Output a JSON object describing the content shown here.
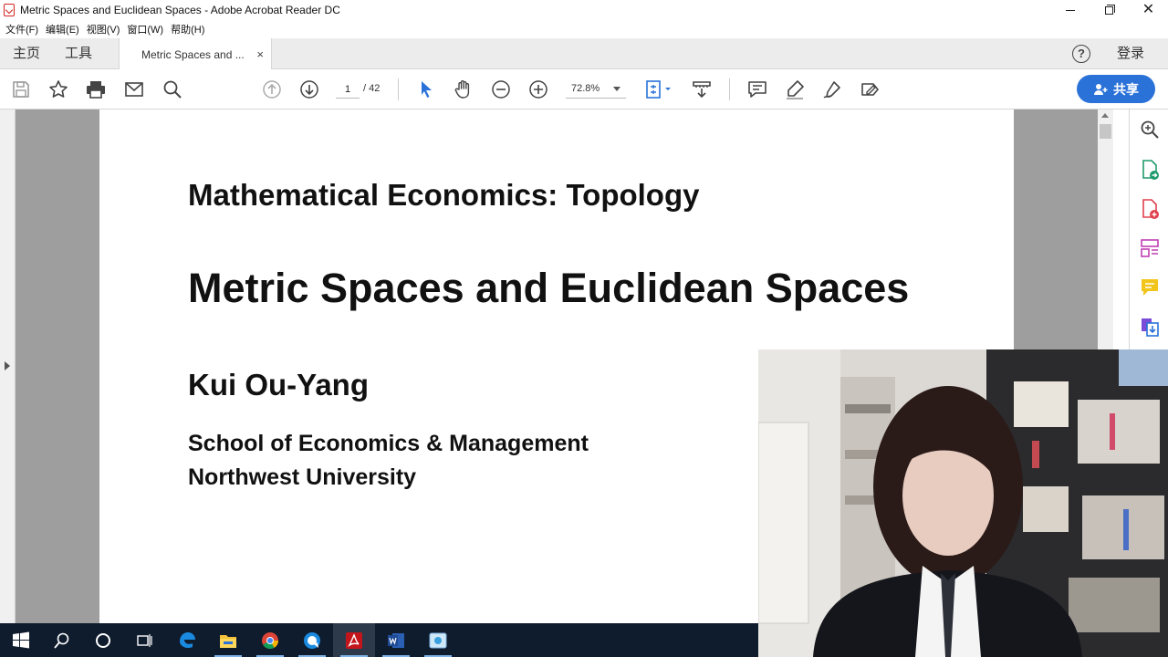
{
  "window": {
    "title": "Metric Spaces and Euclidean Spaces - Adobe Acrobat Reader DC",
    "minimize": "–",
    "close": "✕"
  },
  "menu": [
    "文件(F)",
    "编辑(E)",
    "视图(V)",
    "窗口(W)",
    "帮助(H)"
  ],
  "tabs": {
    "home": "主页",
    "tools": "工具",
    "document": "Metric Spaces and ...",
    "document_close": "×",
    "help": "?",
    "login": "登录"
  },
  "toolbar": {
    "page_current": "1",
    "page_total": "/ 42",
    "zoom": "72.8%",
    "share_label": "共享",
    "icons": [
      "save-icon",
      "bookmark-star-icon",
      "print-icon",
      "email-icon",
      "search-icon",
      "prev-page-icon",
      "next-page-icon",
      "select-cursor-icon",
      "hand-tool-icon",
      "zoom-out-icon",
      "zoom-in-icon",
      "fit-page-icon",
      "scroll-mode-icon",
      "comment-icon",
      "highlight-pen-icon",
      "sign-icon",
      "fill-sign-icon"
    ]
  },
  "document": {
    "course_title": "Mathematical Economics: Topology",
    "title": "Metric Spaces and Euclidean Spaces",
    "author": "Kui Ou-Yang",
    "affiliation_1": "School of Economics & Management",
    "affiliation_2": "Northwest University"
  },
  "right_pane": {
    "icons": [
      "enhance-zoom-icon",
      "export-pdf-icon",
      "create-pdf-icon",
      "organize-pages-icon",
      "comment-tool-icon",
      "send-files-icon"
    ]
  },
  "taskbar": {
    "icons": [
      "windows-start-icon",
      "search-icon",
      "cortana-icon",
      "task-view-icon",
      "edge-icon",
      "file-explorer-icon",
      "chrome-icon",
      "messenger-icon",
      "acrobat-icon",
      "word-icon",
      "screen-capture-icon"
    ]
  },
  "colors": {
    "accent": "#2a72d8",
    "acrobat_red": "#d4241d",
    "doc_background": "#9e9e9e",
    "taskbar": "#0f1c2e"
  }
}
